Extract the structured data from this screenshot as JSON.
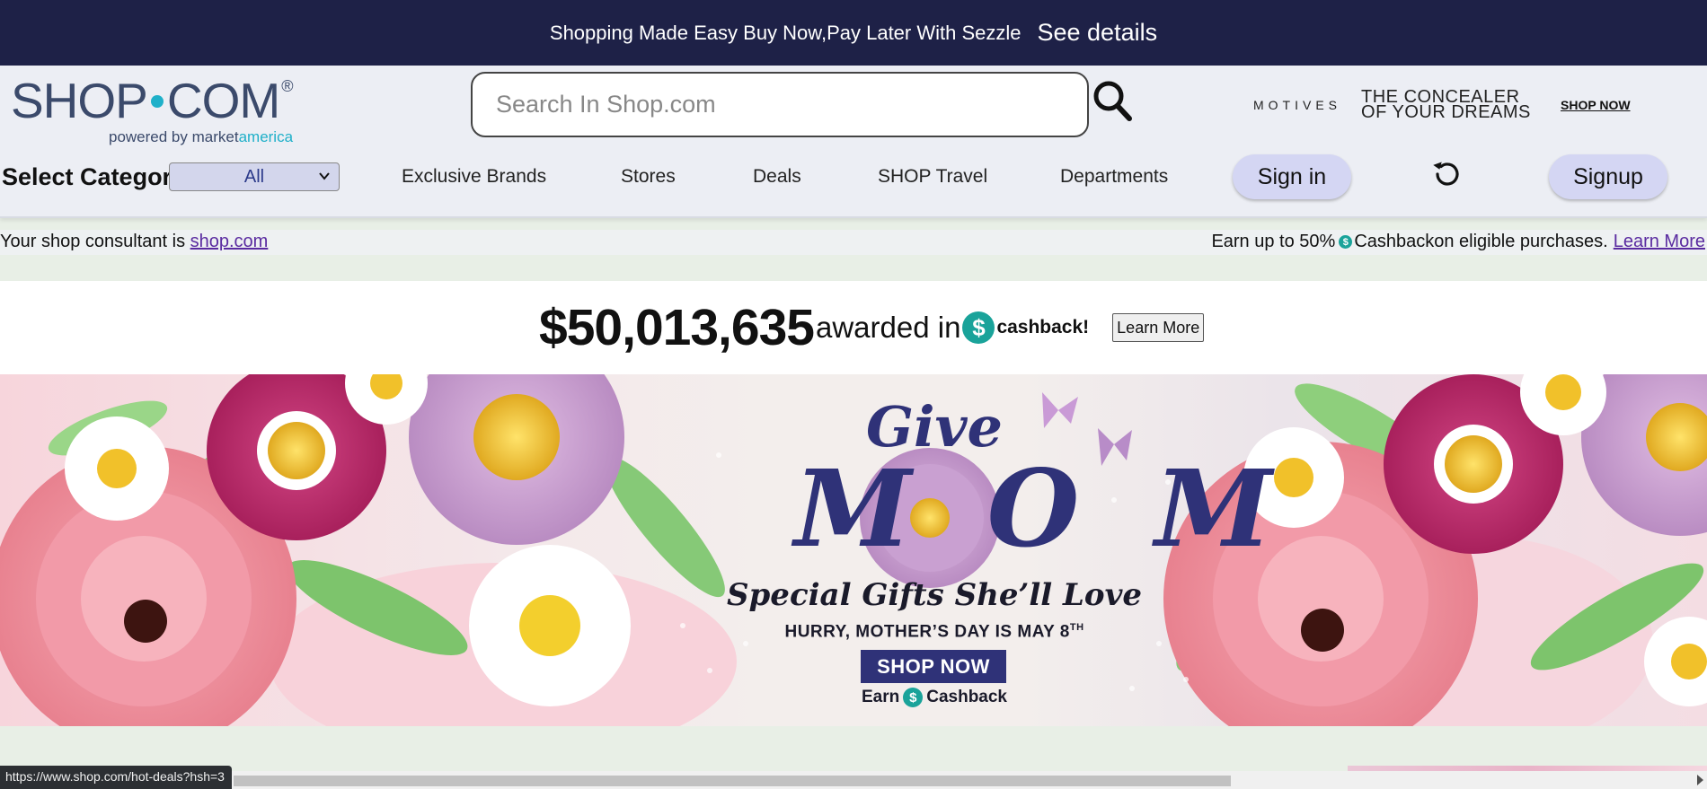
{
  "promo": {
    "text": "Shopping Made Easy Buy Now,Pay Later With Sezzle",
    "link": "See details"
  },
  "logo": {
    "left": "SHOP",
    "right": "COM",
    "reg": "®",
    "powered_by": "powered by market",
    "powered_by_accent": "america"
  },
  "search": {
    "placeholder": "Search In Shop.com",
    "value": ""
  },
  "ad": {
    "brand": "MOTIVES",
    "tagline": "THE CONCEALER OF YOUR DREAMS",
    "cta": "SHOP NOW"
  },
  "nav": {
    "category_label": "Select Category",
    "category_selected": "All",
    "links": [
      "Exclusive Brands",
      "Stores",
      "Deals",
      "SHOP Travel",
      "Departments"
    ],
    "sign_in": "Sign in",
    "signup": "Signup"
  },
  "consultant": {
    "prefix": "Your shop consultant is ",
    "name": "shop.com",
    "cashback_prefix": "Earn up to 50%",
    "cashback_coin": "$",
    "cashback_suffix": "Cashbackon eligible purchases.",
    "learn_more": "Learn More"
  },
  "cashback": {
    "amount": "$50,013,635",
    "awarded": "awarded in",
    "coin": "$",
    "word": "cashback!",
    "learn_more": "Learn More"
  },
  "hero": {
    "give": "Give",
    "mom": "MOM",
    "special": "Special Gifts She’ll Love",
    "hurry": "HURRY, MOTHER’S DAY IS MAY 8",
    "hurry_sup": "TH",
    "shop_now": "SHOP NOW",
    "earn": "Earn",
    "coin": "$",
    "cashback": "Cashback"
  },
  "status": {
    "url": "https://www.shop.com/hot-deals?hsh=3"
  },
  "colors": {
    "promo_bar": "#1e2147",
    "header_bg": "#eceef4",
    "pill": "#d4d6f3",
    "accent_teal": "#1aa39a",
    "brand_navy": "#2f3278"
  }
}
